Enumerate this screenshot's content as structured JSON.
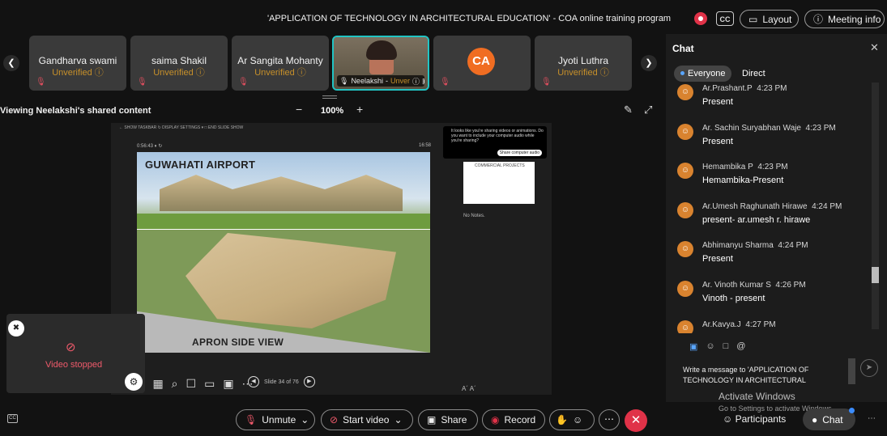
{
  "meeting": {
    "title": "'APPLICATION OF TECHNOLOGY IN ARCHITECTURAL EDUCATION' - COA online training program",
    "cc_label": "CC",
    "layout_label": "Layout",
    "meeting_info_label": "Meeting info"
  },
  "participants": [
    {
      "name": "Gandharva swami",
      "status": "Unverified ⓘ"
    },
    {
      "name": "saima Shakil",
      "status": "Unverified ⓘ"
    },
    {
      "name": "Ar Sangita Mohanty",
      "status": "Unverified ⓘ"
    },
    {
      "name": "Neelakshi",
      "status": "Unver"
    },
    {
      "name": "",
      "logo_text": "CA"
    },
    {
      "name": "Jyoti Luthra",
      "status": "Unverified ⓘ"
    }
  ],
  "share": {
    "label": "Viewing Neelakshi's shared content",
    "zoom": "100%",
    "zoom_minus": "−",
    "zoom_plus": "+"
  },
  "presentation": {
    "toolbar_text": "←  SHOW TASKBAR     ↻  DISPLAY SETTINGS ▾     □  END SLIDE SHOW",
    "timer": "0:56:43  ⏸  ↻",
    "clock": "16:58",
    "slide_title_top": "GUWAHATI AIRPORT",
    "slide_title_bottom": "APRON SIDE VIEW",
    "notes_thumb": "COMMERCIAL PROJECTS",
    "no_notes": "No Notes.",
    "popup_text": "It looks like you're sharing videos or animations. Do you want to include your computer audio while you're sharing?",
    "popup_button": "Share computer audio",
    "slide_counter": "Slide 34 of 76",
    "small_label": "A´ A´"
  },
  "self_view": {
    "video_stopped": "Video stopped"
  },
  "chat": {
    "title": "Chat",
    "tab_everyone": "Everyone",
    "tab_direct": "Direct",
    "messages": [
      {
        "author": "Ar.Prashant.P",
        "time": "4:23 PM",
        "text": "Present"
      },
      {
        "author": "Ar. Sachin Suryabhan Waje",
        "time": "4:23 PM",
        "text": "Present"
      },
      {
        "author": "Hemambika P",
        "time": "4:23 PM",
        "text": "Hemambika-Present"
      },
      {
        "author": "Ar.Umesh Raghunath Hirawe",
        "time": "4:24 PM",
        "text": "present- ar.umesh r. hirawe"
      },
      {
        "author": "Abhimanyu Sharma",
        "time": "4:24 PM",
        "text": "Present"
      },
      {
        "author": "Ar. Vinoth Kumar S",
        "time": "4:26 PM",
        "text": "Vinoth - present"
      },
      {
        "author": "Ar.Kavya.J",
        "time": "4:27 PM",
        "text": ""
      }
    ],
    "compose_placeholder": "Write a message to 'APPLICATION OF TECHNOLOGY IN ARCHITECTURAL",
    "watermark_title": "Activate Windows",
    "watermark_sub": "Go to Settings to activate Windows."
  },
  "controls": {
    "unmute": "Unmute",
    "start_video": "Start video",
    "share": "Share",
    "record": "Record",
    "participants": "Participants",
    "chat": "Chat"
  },
  "colors": {
    "accent_teal": "#21c4c4",
    "unverified": "#c7902a",
    "danger": "#e03248",
    "avatar": "#d9832f"
  }
}
